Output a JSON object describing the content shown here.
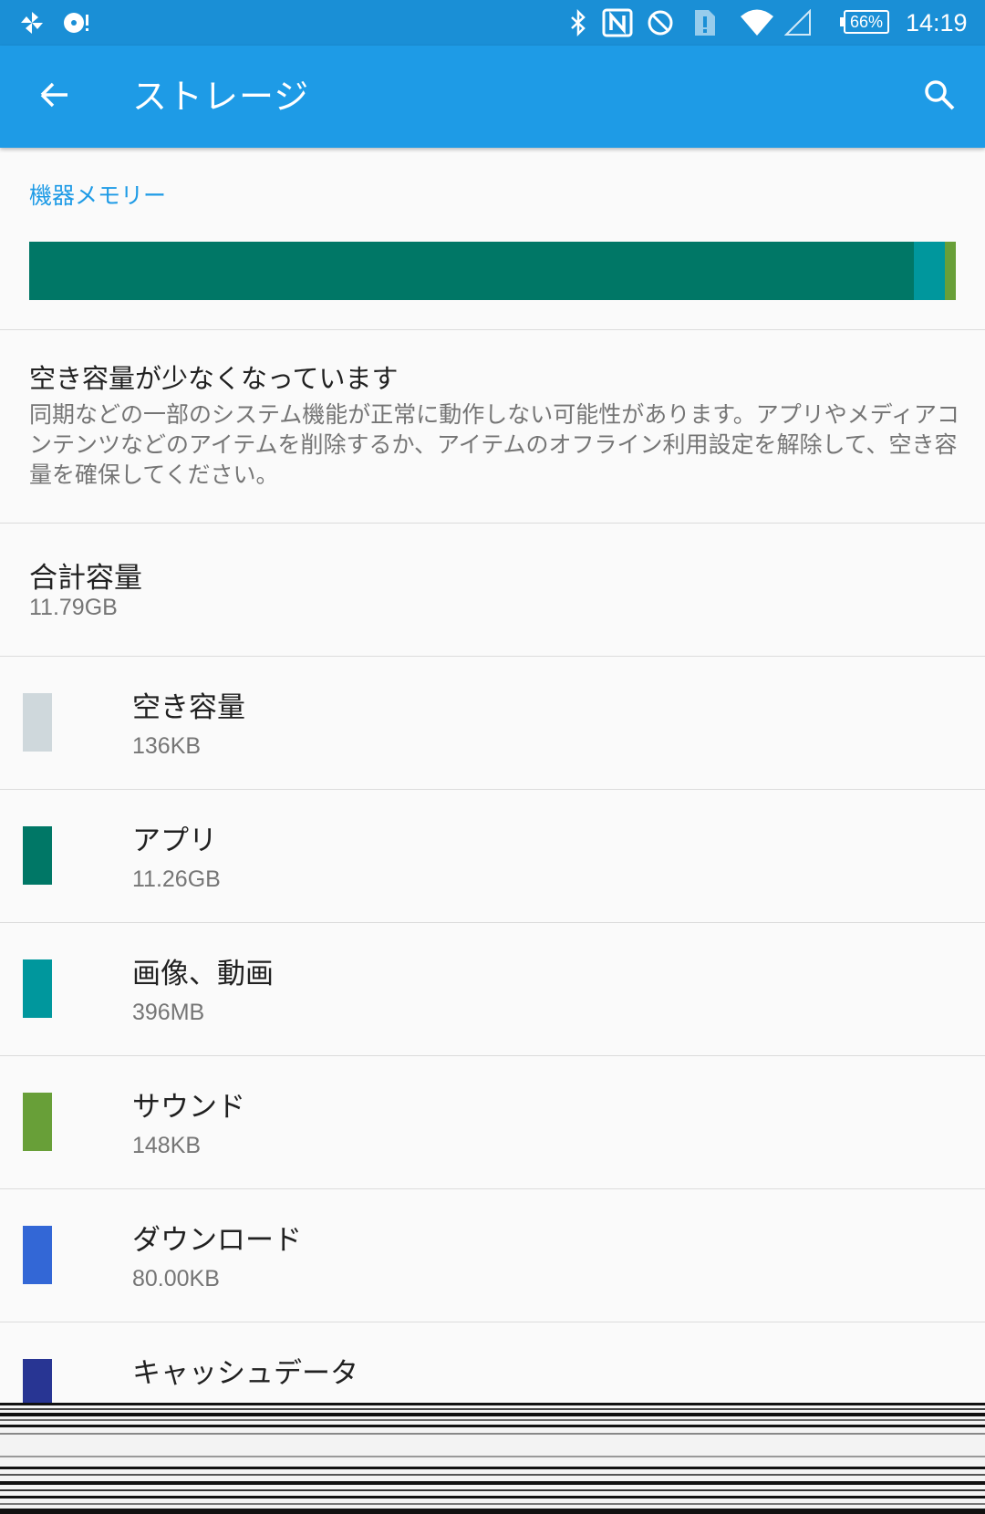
{
  "status_bar": {
    "icons": [
      "pinwheel-icon",
      "cd-notification-icon",
      "bluetooth-icon",
      "nfc-icon",
      "do-not-disturb-icon",
      "sim-alert-icon",
      "wifi-icon",
      "cell-signal-icon"
    ],
    "battery": "66%",
    "time": "14:19"
  },
  "app_bar": {
    "title": "ストレージ",
    "back_icon": "arrow-back-icon",
    "search_icon": "search-icon"
  },
  "section": {
    "label": "機器メモリー"
  },
  "usage_bar": {
    "segments": [
      {
        "name": "アプリ",
        "fraction": 0.955,
        "color": "#007766"
      },
      {
        "name": "画像、動画",
        "fraction": 0.033,
        "color": "#00979d"
      },
      {
        "name": "サウンド",
        "fraction": 0.012,
        "color": "#689f38"
      }
    ]
  },
  "warning": {
    "title": "空き容量が少なくなっています",
    "body": "同期などの一部のシステム機能が正常に動作しない可能性があります。アプリやメディアコンテンツなどのアイテムを削除するか、アイテムのオフライン利用設定を解除して、空き容量を確保してください。"
  },
  "total": {
    "label": "合計容量",
    "value": "11.79GB"
  },
  "categories": [
    {
      "label": "空き容量",
      "size": "136KB",
      "color": "#cfd8dc"
    },
    {
      "label": "アプリ",
      "size": "11.26GB",
      "color": "#007766"
    },
    {
      "label": "画像、動画",
      "size": "396MB",
      "color": "#00979d"
    },
    {
      "label": "サウンド",
      "size": "148KB",
      "color": "#689f38"
    },
    {
      "label": "ダウンロード",
      "size": "80.00KB",
      "color": "#3367d6"
    },
    {
      "label": "キャッシュデータ",
      "size": "",
      "color": "#283593"
    }
  ]
}
